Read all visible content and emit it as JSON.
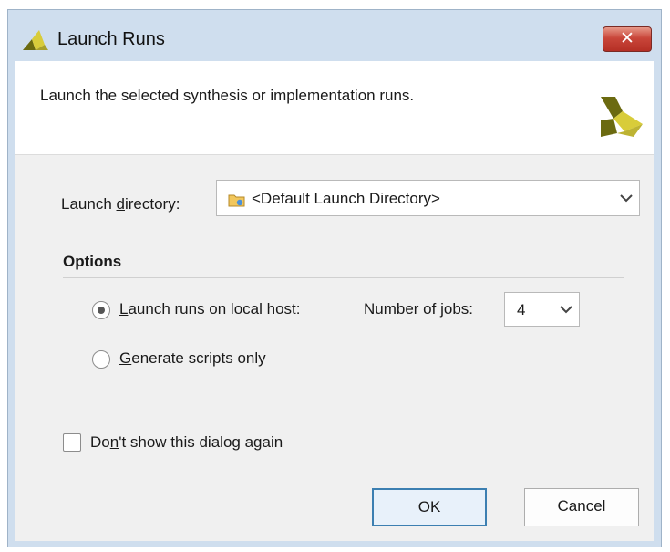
{
  "window": {
    "title": "Launch Runs",
    "close_symbol": "✕"
  },
  "header": {
    "description": "Launch the selected synthesis or implementation runs.",
    "logo_icon": "vivado-logo-icon"
  },
  "launch_directory": {
    "label_before": "Launch ",
    "label_mnemonic": "d",
    "label_after": "irectory:",
    "value": "<Default Launch Directory>",
    "icon": "folder-icon"
  },
  "options": {
    "title": "Options",
    "local_host": {
      "label_mnemonic": "L",
      "label_rest": "aunch runs on local host:",
      "selected": true
    },
    "jobs": {
      "label_before": "Number of ",
      "label_mnemonic": "j",
      "label_after": "obs:",
      "value": "4"
    },
    "scripts_only": {
      "label_mnemonic": "G",
      "label_rest": "enerate scripts only",
      "selected": false
    }
  },
  "dont_show": {
    "label_before": "Do",
    "label_mnemonic": "n",
    "label_after": "'t show this dialog again",
    "checked": false
  },
  "buttons": {
    "ok": "OK",
    "cancel": "Cancel"
  },
  "colors": {
    "title_bar": "#cfdeee",
    "client_bg": "#f0f0f0",
    "close_button": "#c9463a",
    "ok_border": "#3c7fb1",
    "logo_dark": "#6b6a10",
    "logo_yellow": "#d8cc3a"
  }
}
